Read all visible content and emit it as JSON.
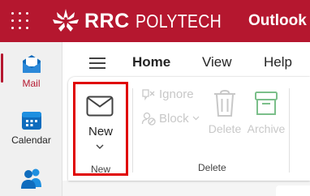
{
  "header": {
    "brand_rrc": "RRC",
    "brand_polytech": "POLYTECH",
    "app_name": "Outlook",
    "bg_color": "#b5172f"
  },
  "rail": {
    "items": [
      {
        "label": "Mail",
        "icon": "mail-icon",
        "active": true
      },
      {
        "label": "Calendar",
        "icon": "calendar-icon",
        "active": false
      },
      {
        "label": "",
        "icon": "people-icon",
        "active": false
      }
    ]
  },
  "tabs": [
    {
      "label": "Home",
      "selected": true
    },
    {
      "label": "View",
      "selected": false
    },
    {
      "label": "Help",
      "selected": false
    }
  ],
  "ribbon": {
    "new": {
      "label": "New",
      "group_label": "New",
      "icon": "envelope-icon"
    },
    "ignore": {
      "label": "Ignore",
      "icon": "ignore-icon",
      "enabled": false
    },
    "block": {
      "label": "Block",
      "icon": "block-icon",
      "enabled": false
    },
    "delete": {
      "label": "Delete",
      "icon": "trash-icon",
      "enabled": false
    },
    "archive": {
      "label": "Archive",
      "icon": "archive-icon",
      "enabled": false
    },
    "delete_group_label": "Delete"
  },
  "colors": {
    "accent": "#b5172f",
    "highlight_box": "#e00000",
    "disabled_text": "#c8c8c8",
    "archive_icon": "#7bbf8a"
  }
}
